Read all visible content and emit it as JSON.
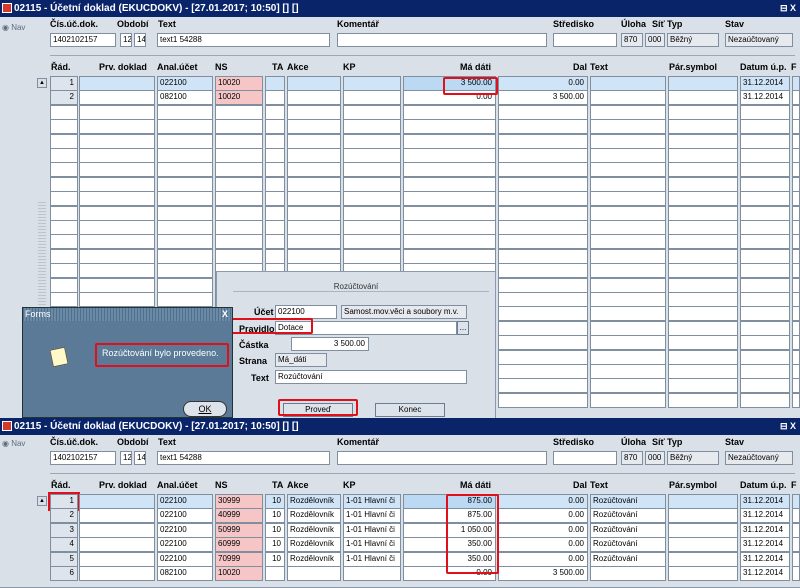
{
  "top": {
    "title": "02115 - Účetní doklad (EKUCDOKV) - [27.01.2017; 10:50] [] []",
    "controls": "⊟ X",
    "nav": "Nav",
    "header_labels": [
      "Čís.úč.dok.",
      "Období",
      "Text",
      "Komentář",
      "Středisko",
      "Úloha",
      "Síť",
      "Typ",
      "Stav"
    ],
    "doc_no": "1402102157",
    "period_a": "12",
    "period_b": "14",
    "text": "text1 54288",
    "komentar": "",
    "stredisko": "",
    "uloha": "870",
    "sit": "000",
    "typ": "Běžný",
    "stav": "Nezaúčtovaný",
    "grid_headers": [
      "Řád.",
      "Prv. doklad",
      "Anal.účet",
      "NS",
      "TA",
      "Akce",
      "KP",
      "Má dáti",
      "Dal",
      "Text",
      "Pár.symbol",
      "Datum ú.p.",
      "F"
    ],
    "rows": [
      {
        "no": "1",
        "acct": "022100",
        "ns": "10020",
        "ma_dati": "3 500.00",
        "dal": "0.00",
        "date": "31.12.2014"
      },
      {
        "no": "2",
        "acct": "082100",
        "ns": "10020",
        "ma_dati": "0.00",
        "dal": "3 500.00",
        "date": "31.12.2014"
      }
    ]
  },
  "rozuctovani": {
    "title": "Rozúčtování",
    "ucet_label": "Účet",
    "ucet": "022100",
    "ucet_desc": "Samost.mov.věci a soubory m.v.",
    "pravidlo_label": "Pravidlo",
    "pravidlo": "Dotace",
    "pravidlo_btn": "...",
    "castka_label": "Částka",
    "castka": "3 500.00",
    "strana_label": "Strana",
    "strana": "Má_dáti",
    "text_label": "Text",
    "text": "Rozúčtování",
    "provest": "Proveď",
    "konec": "Konec"
  },
  "forms": {
    "title": "Forms",
    "close": "X",
    "message": "Rozúčtování bylo provedeno.",
    "ok": "OK"
  },
  "bottom": {
    "title": "02115 - Účetní doklad (EKUCDOKV) - [27.01.2017; 10:50] [] []",
    "controls": "⊟ X",
    "nav": "Nav",
    "header_labels": [
      "Čís.úč.dok.",
      "Období",
      "Text",
      "Komentář",
      "Středisko",
      "Úloha",
      "Síť",
      "Typ",
      "Stav"
    ],
    "doc_no": "1402102157",
    "period_a": "12",
    "period_b": "14",
    "text": "text1 54288",
    "komentar": "",
    "stredisko": "",
    "uloha": "870",
    "sit": "000",
    "typ": "Běžný",
    "stav": "Nezaúčtovaný",
    "grid_headers": [
      "Řád.",
      "Prv. doklad",
      "Anal.účet",
      "NS",
      "TA",
      "Akce",
      "KP",
      "Má dáti",
      "Dal",
      "Text",
      "Pár.symbol",
      "Datum ú.p.",
      "F"
    ],
    "rows": [
      {
        "no": "1",
        "acct": "022100",
        "ns": "30999",
        "ta": "10",
        "akce": "Rozdělovník",
        "kp": "1-01 Hlavní či",
        "ma_dati": "875.00",
        "dal": "0.00",
        "text": "Rozúčtování",
        "date": "31.12.2014"
      },
      {
        "no": "2",
        "acct": "022100",
        "ns": "40999",
        "ta": "10",
        "akce": "Rozdělovník",
        "kp": "1-01 Hlavní či",
        "ma_dati": "875.00",
        "dal": "0.00",
        "text": "Rozúčtování",
        "date": "31.12.2014"
      },
      {
        "no": "3",
        "acct": "022100",
        "ns": "50999",
        "ta": "10",
        "akce": "Rozdělovník",
        "kp": "1-01 Hlavní či",
        "ma_dati": "1 050.00",
        "dal": "0.00",
        "text": "Rozúčtování",
        "date": "31.12.2014"
      },
      {
        "no": "4",
        "acct": "022100",
        "ns": "60999",
        "ta": "10",
        "akce": "Rozdělovník",
        "kp": "1-01 Hlavní či",
        "ma_dati": "350.00",
        "dal": "0.00",
        "text": "Rozúčtování",
        "date": "31.12.2014"
      },
      {
        "no": "5",
        "acct": "022100",
        "ns": "70999",
        "ta": "10",
        "akce": "Rozdělovník",
        "kp": "1-01 Hlavní či",
        "ma_dati": "350.00",
        "dal": "0.00",
        "text": "Rozúčtování",
        "date": "31.12.2014"
      },
      {
        "no": "6",
        "acct": "082100",
        "ns": "10020",
        "ta": "",
        "akce": "",
        "kp": "",
        "ma_dati": "0.00",
        "dal": "3 500.00",
        "text": "",
        "date": "31.12.2014"
      }
    ]
  }
}
